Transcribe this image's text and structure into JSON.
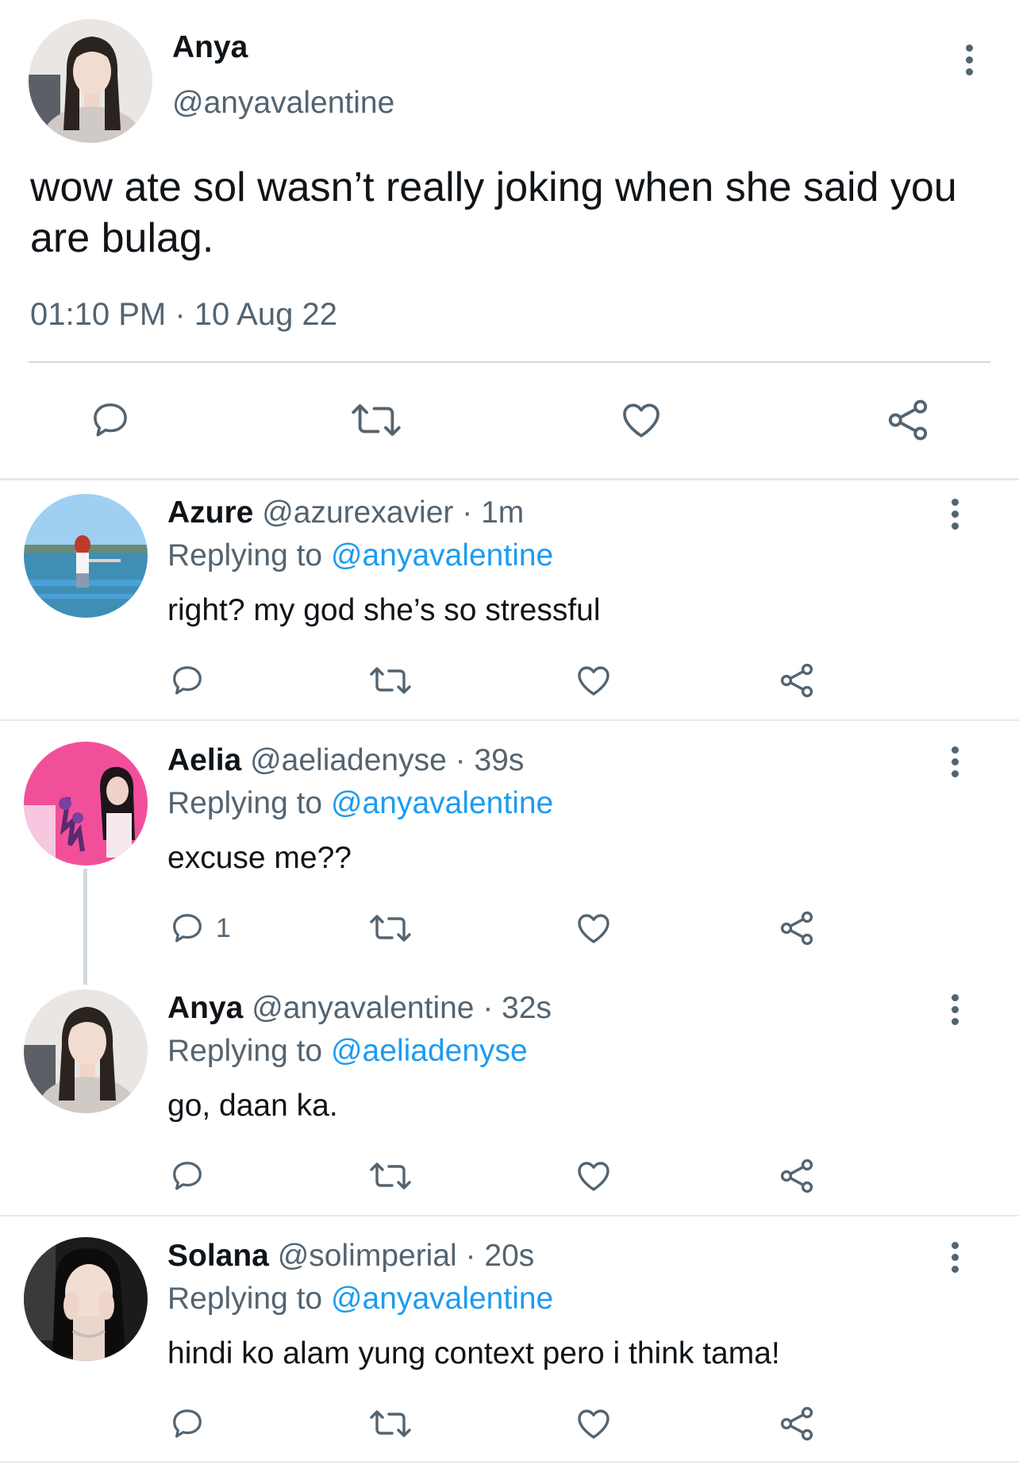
{
  "main_tweet": {
    "name": "Anya",
    "handle": "@anyavalentine",
    "text": "wow ate sol wasn’t really joking when she said you are bulag.",
    "timestamp": "01:10 PM · 10 Aug 22",
    "actions": [
      "reply-icon",
      "retweet-icon",
      "like-icon",
      "share-icon"
    ]
  },
  "replies": [
    {
      "name": "Azure",
      "handle": "@azurexavier",
      "time": "1m",
      "replying_label": "Replying to",
      "replying_to": "@anyavalentine",
      "text": "right? my god she’s so stressful",
      "reply_count": ""
    },
    {
      "name": "Aelia",
      "handle": "@aeliadenyse",
      "time": "39s",
      "replying_label": "Replying to",
      "replying_to": "@anyavalentine",
      "text": "excuse me??",
      "reply_count": "1"
    },
    {
      "name": "Anya",
      "handle": "@anyavalentine",
      "time": "32s",
      "replying_label": "Replying to",
      "replying_to": "@aeliadenyse",
      "text": "go, daan ka.",
      "reply_count": ""
    },
    {
      "name": "Solana",
      "handle": "@solimperial",
      "time": "20s",
      "replying_label": "Replying to",
      "replying_to": "@anyavalentine",
      "text": "hindi ko alam yung context pero i think tama!",
      "reply_count": ""
    }
  ],
  "separator": " · ",
  "colors": {
    "text": "#0f1419",
    "secondary": "#536471",
    "link": "#1d9bf0",
    "divider": "#cfd9de"
  }
}
